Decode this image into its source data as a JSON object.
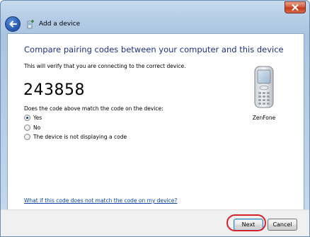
{
  "window": {
    "title": "Add a device"
  },
  "content": {
    "heading": "Compare pairing codes between your computer and this device",
    "subtext": "This will verify that you are connecting to the correct device.",
    "pairing_code": "243858",
    "question": "Does the code above match the code on the device:",
    "options": [
      {
        "label": "Yes",
        "checked": true
      },
      {
        "label": "No",
        "checked": false
      },
      {
        "label": "The device is not displaying a code",
        "checked": false
      }
    ],
    "device": {
      "name": "ZenFone",
      "icon": "mobile-phone-icon"
    },
    "help_link": "What if this code does not match the code on my device?"
  },
  "footer": {
    "next_label": "Next",
    "cancel_label": "Cancel"
  },
  "colors": {
    "heading": "#1e3287",
    "link": "#0b44a3",
    "highlight": "#d6202a"
  }
}
